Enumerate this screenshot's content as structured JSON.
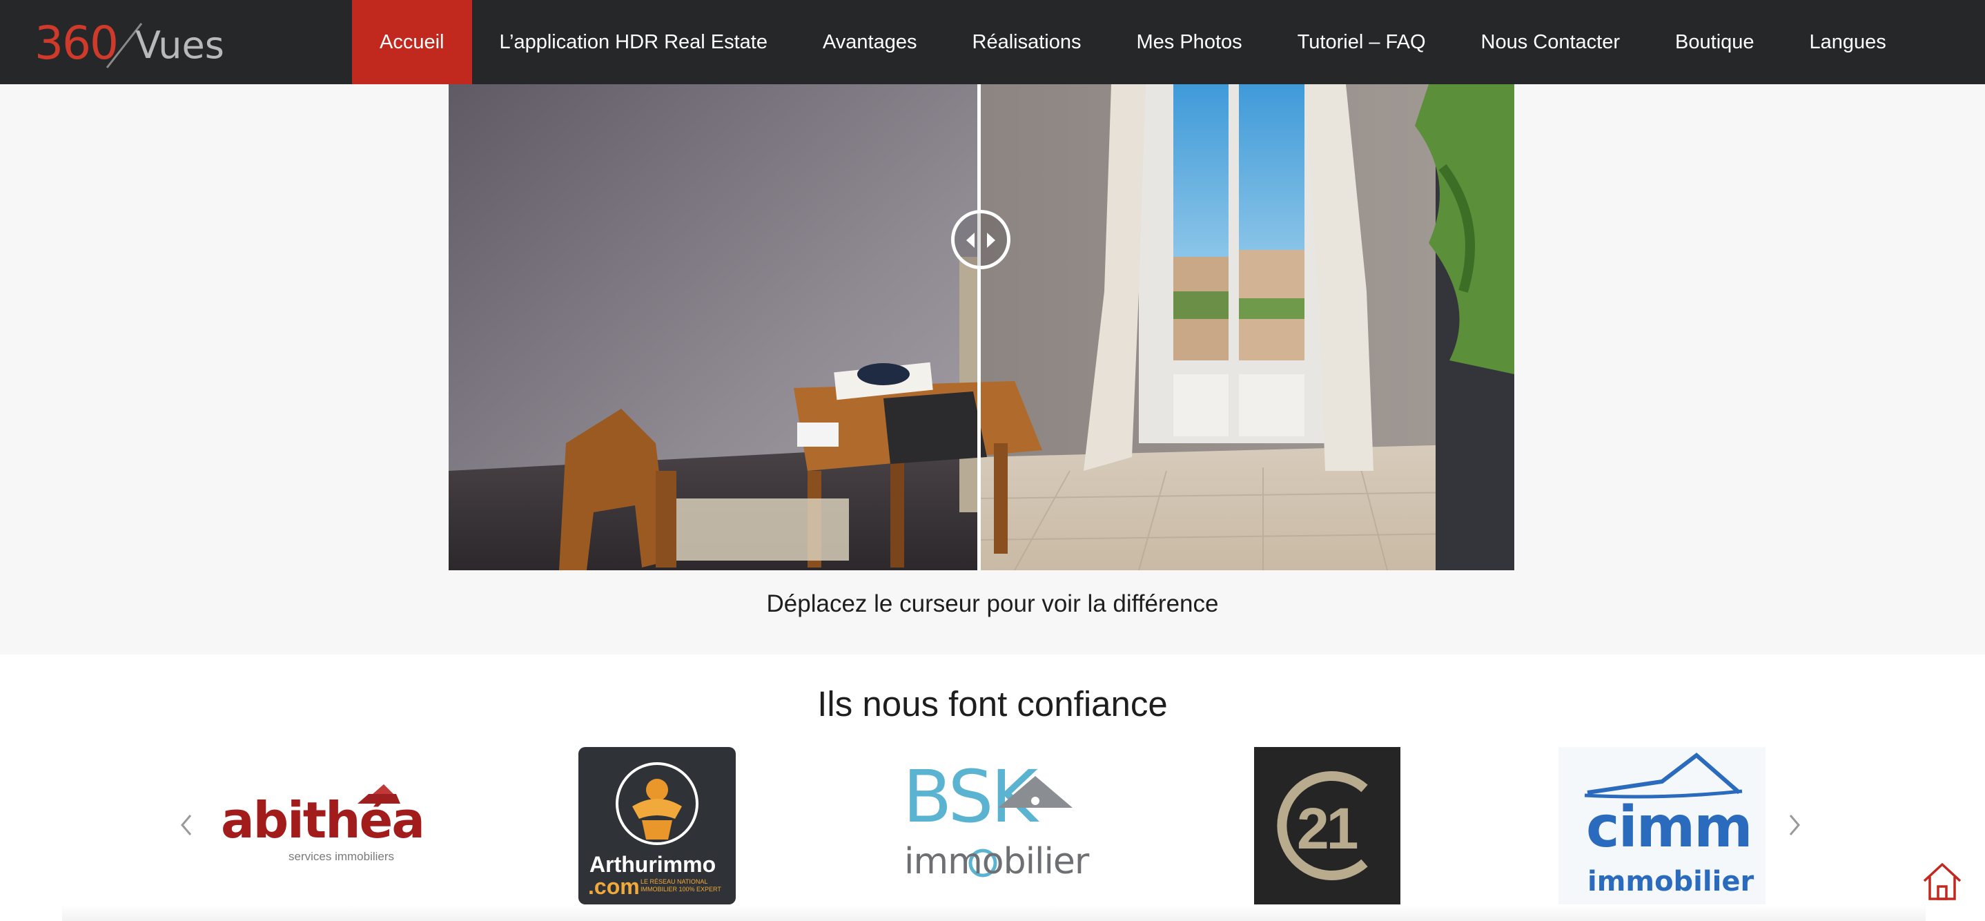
{
  "brand": {
    "logo_number": "360",
    "logo_word": "Vues",
    "accent_color": "#c1281e",
    "nav_bg": "#262728"
  },
  "nav": {
    "items": [
      {
        "label": "Accueil",
        "active": true
      },
      {
        "label": "L’application HDR Real Estate",
        "active": false
      },
      {
        "label": "Avantages",
        "active": false
      },
      {
        "label": "Réalisations",
        "active": false
      },
      {
        "label": "Mes Photos",
        "active": false
      },
      {
        "label": "Tutoriel – FAQ",
        "active": false
      },
      {
        "label": "Nous Contacter",
        "active": false
      },
      {
        "label": "Boutique",
        "active": false
      },
      {
        "label": "Langues",
        "active": false
      }
    ]
  },
  "compare": {
    "caption": "Déplacez le curseur pour voir la différence",
    "handle_icon": "left-right-arrows-icon",
    "slider_position": 0.5
  },
  "trust": {
    "title": "Ils nous font confiance",
    "prev_icon": "chevron-left-icon",
    "next_icon": "chevron-right-icon",
    "logos": [
      {
        "name": "abithea",
        "main": "abithéa",
        "sub": "services immobiliers"
      },
      {
        "name": "arthurimmo",
        "main": "Arthurimmo",
        "sub": ".com",
        "tagline": "LE RÉSEAU NATIONAL IMMOBILIER 100% EXPERT"
      },
      {
        "name": "bsk",
        "main": "BSK",
        "sub": "immobilier"
      },
      {
        "name": "century21",
        "main": "21"
      },
      {
        "name": "cimm",
        "main": "cimm",
        "sub": "immobilier"
      }
    ]
  },
  "floating": {
    "home_icon": "home-icon"
  }
}
